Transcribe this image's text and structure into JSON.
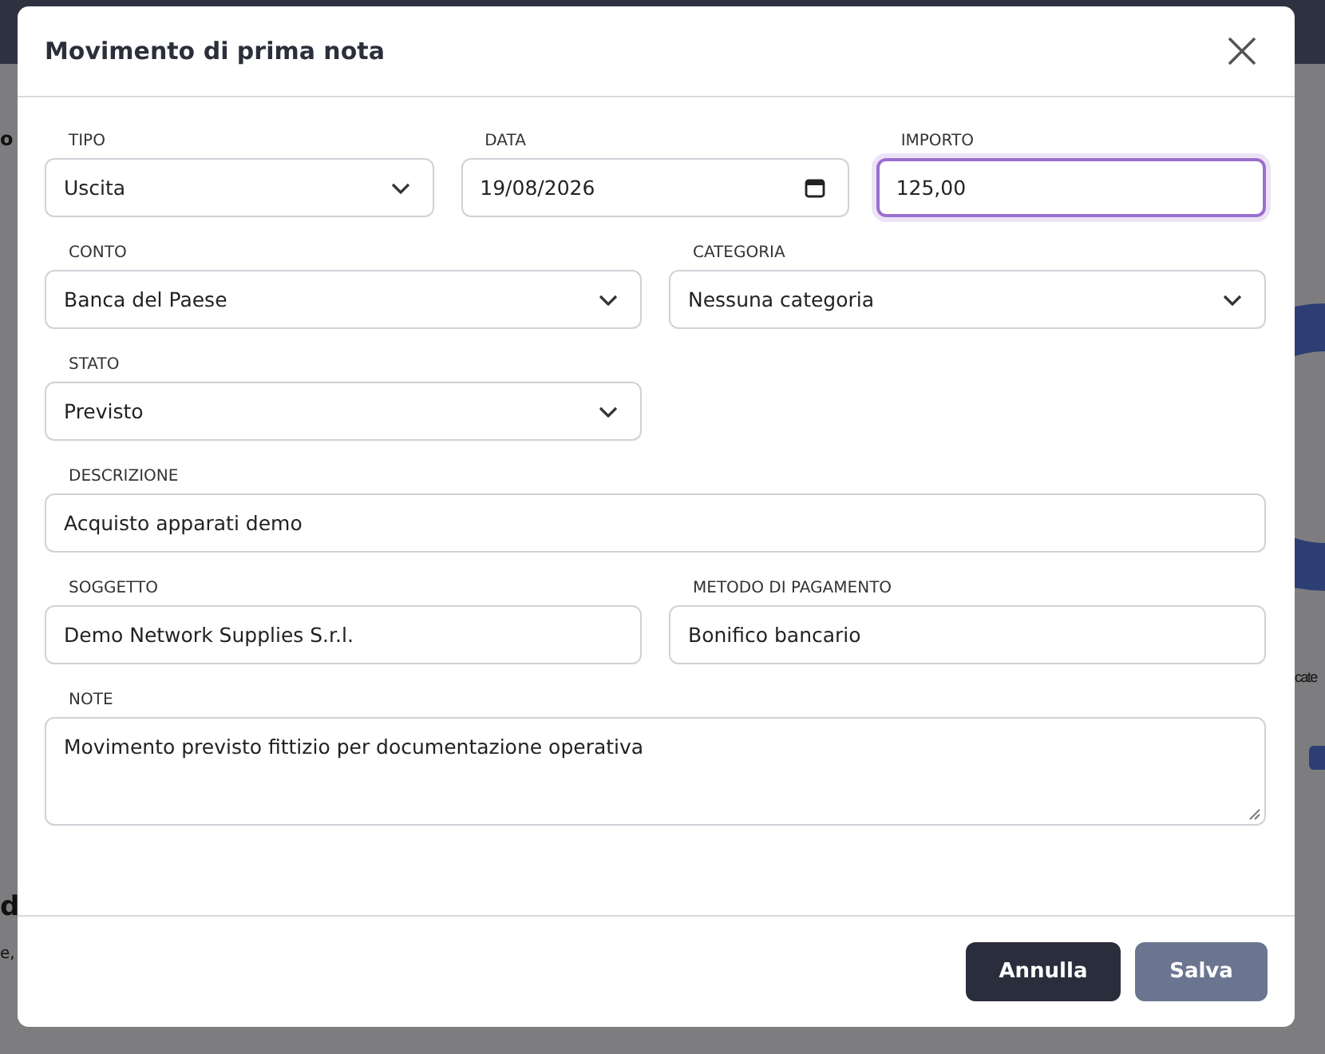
{
  "background": {
    "left_fragments": [
      "o",
      "d",
      "e,"
    ],
    "right_fragments": [
      "cate"
    ]
  },
  "dialog": {
    "title": "Movimento di prima nota",
    "rows": [
      [
        {
          "label": "TIPO",
          "kind": "select",
          "value": "Uscita",
          "focused": false
        },
        {
          "label": "DATA",
          "kind": "date",
          "value": "19/08/2026",
          "focused": false
        },
        {
          "label": "IMPORTO",
          "kind": "text",
          "value": "125,00",
          "focused": true
        }
      ],
      [
        {
          "label": "CONTO",
          "kind": "select",
          "value": "Banca del Paese",
          "focused": false
        },
        {
          "label": "CATEGORIA",
          "kind": "select",
          "value": "Nessuna categoria",
          "focused": false
        }
      ],
      [
        {
          "label": "STATO",
          "kind": "select",
          "value": "Previsto",
          "focused": false
        },
        {
          "kind": "spacer"
        }
      ],
      [
        {
          "label": "DESCRIZIONE",
          "kind": "text",
          "value": "Acquisto apparati demo",
          "focused": false
        }
      ],
      [
        {
          "label": "SOGGETTO",
          "kind": "text",
          "value": "Demo Network Supplies S.r.l.",
          "focused": false
        },
        {
          "label": "METODO DI PAGAMENTO",
          "kind": "text",
          "value": "Bonifico bancario",
          "focused": false
        }
      ],
      [
        {
          "label": "NOTE",
          "kind": "textarea",
          "value": "Movimento previsto fittizio per documentazione operativa",
          "focused": false
        }
      ]
    ],
    "buttons": [
      {
        "label": "Annulla",
        "disabled": false
      },
      {
        "label": "Salva",
        "disabled": true
      }
    ]
  }
}
